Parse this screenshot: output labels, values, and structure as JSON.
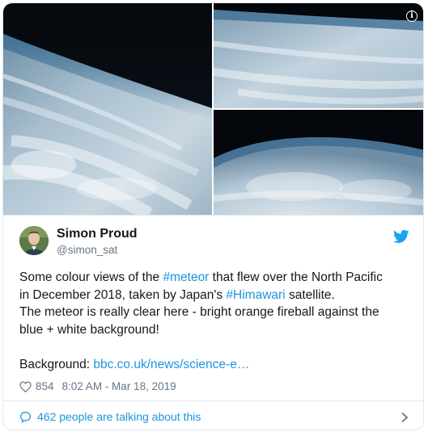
{
  "media": {
    "images": [
      {
        "icon": "earth-satellite-image"
      },
      {
        "icon": "earth-satellite-image"
      },
      {
        "icon": "earth-satellite-image"
      }
    ],
    "info_icon": "i"
  },
  "tweet": {
    "author_name": "Simon Proud",
    "author_handle": "@simon_sat",
    "line1_pre": "Some colour views of the ",
    "hashtag1": "#meteor",
    "line1_post": " that flew over the North Pacific",
    "line2_pre": "in December 2018, taken by Japan's ",
    "hashtag2": "#Himawari",
    "line2_post": " satellite.",
    "line3": "The meteor is really clear here - bright orange fireball against the",
    "line4": "blue + white background!",
    "background_label": "Background: ",
    "background_link": "bbc.co.uk/news/science-e…",
    "likes": "854",
    "timestamp": "8:02 AM - Mar 18, 2019"
  },
  "footer": {
    "talking": "462 people are talking about this"
  },
  "colors": {
    "link": "#1b95e0",
    "secondary_text": "#657786",
    "border": "#e1e8ed"
  }
}
